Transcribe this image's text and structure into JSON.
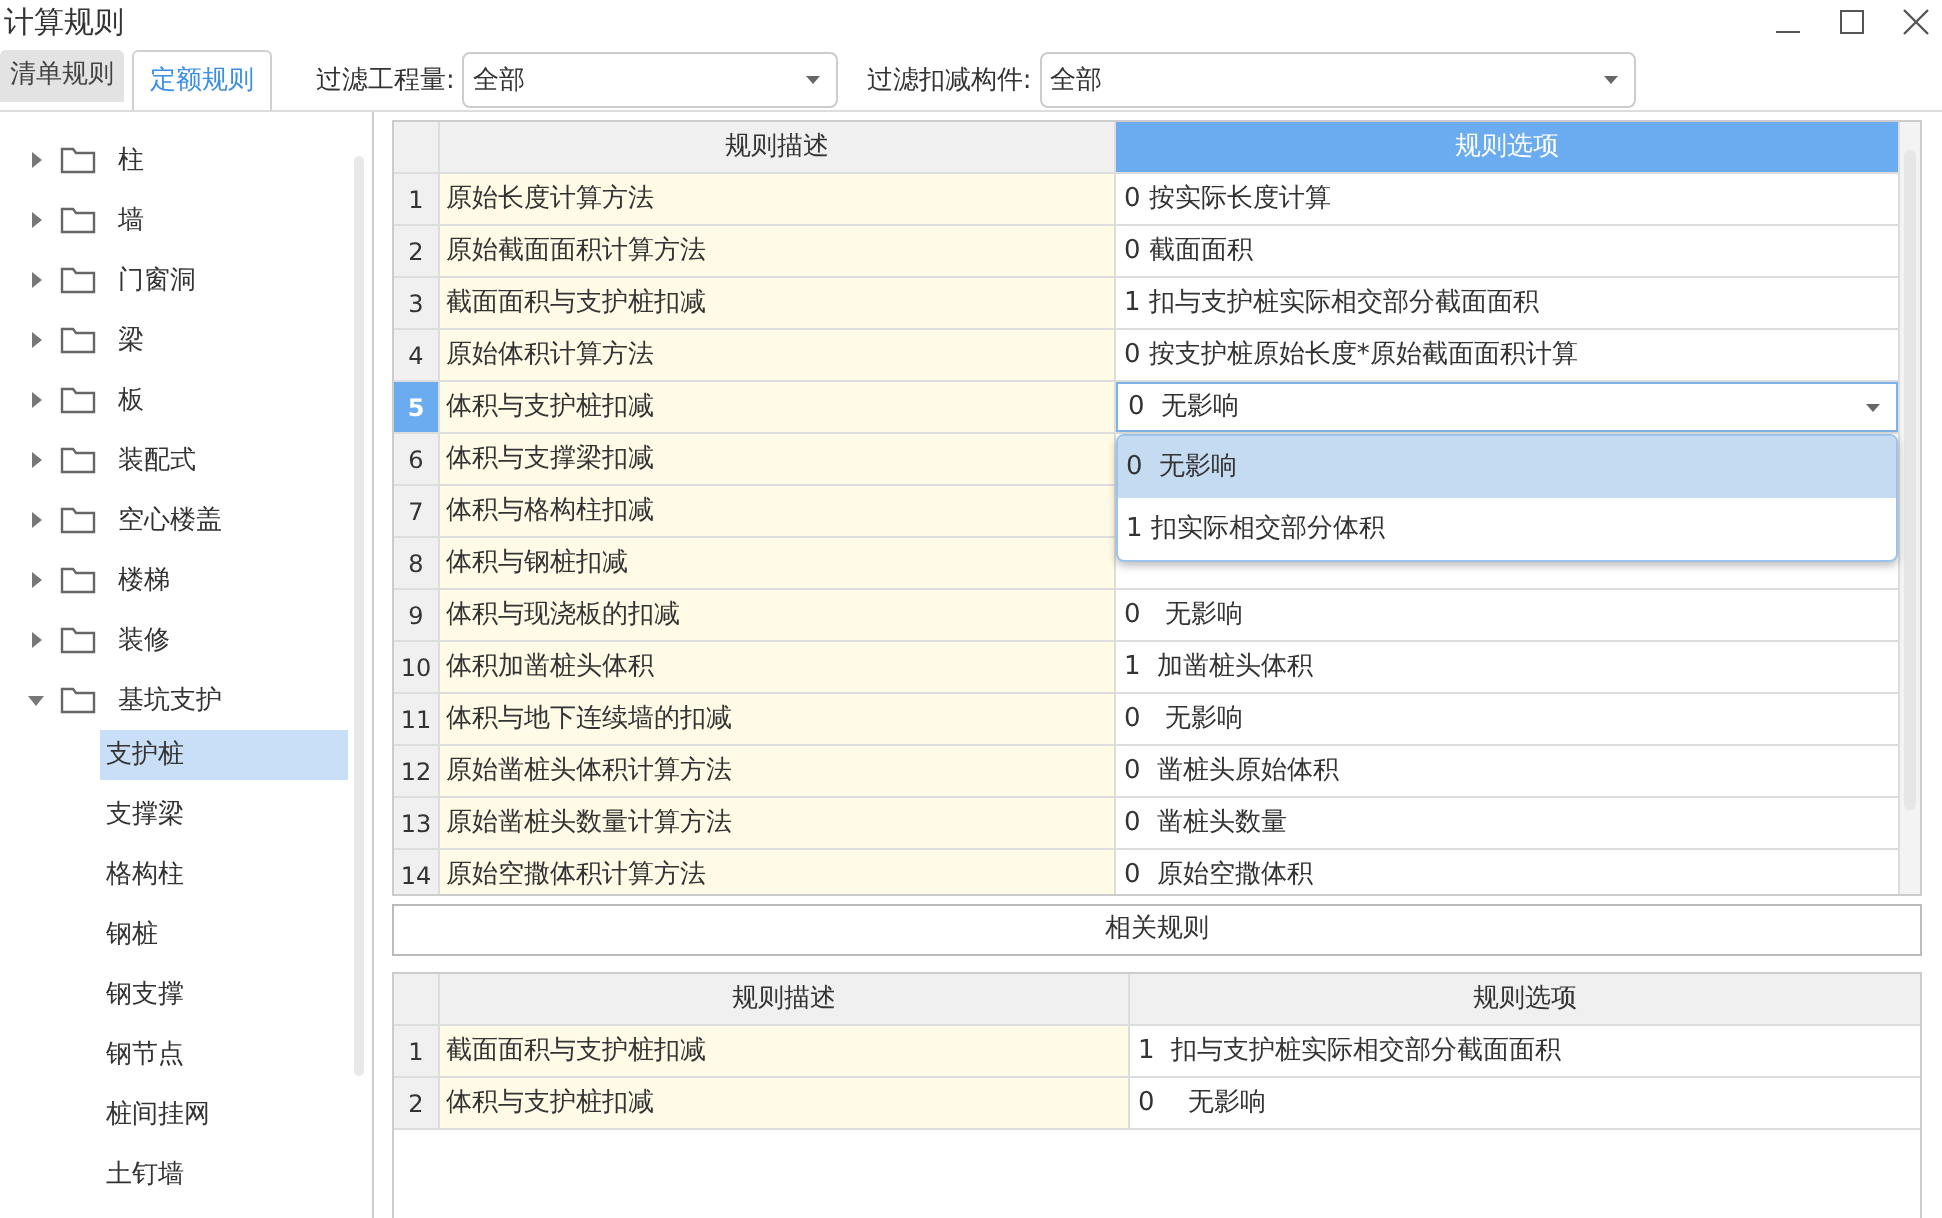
{
  "window": {
    "title": "计算规则"
  },
  "tabs": [
    {
      "label": "清单规则",
      "selected": false
    },
    {
      "label": "定额规则",
      "selected": true
    }
  ],
  "filters": [
    {
      "label": "过滤工程量:",
      "value": "全部"
    },
    {
      "label": "过滤扣减构件:",
      "value": "全部"
    }
  ],
  "tree": [
    {
      "label": "柱",
      "expanded": false
    },
    {
      "label": "墙",
      "expanded": false
    },
    {
      "label": "门窗洞",
      "expanded": false
    },
    {
      "label": "梁",
      "expanded": false
    },
    {
      "label": "板",
      "expanded": false
    },
    {
      "label": "装配式",
      "expanded": false
    },
    {
      "label": "空心楼盖",
      "expanded": false
    },
    {
      "label": "楼梯",
      "expanded": false
    },
    {
      "label": "装修",
      "expanded": false
    },
    {
      "label": "基坑支护",
      "expanded": true,
      "children": [
        {
          "label": "支护桩",
          "selected": true
        },
        {
          "label": "支撑梁",
          "selected": false
        },
        {
          "label": "格构柱",
          "selected": false
        },
        {
          "label": "钢桩",
          "selected": false
        },
        {
          "label": "钢支撑",
          "selected": false
        },
        {
          "label": "钢节点",
          "selected": false
        },
        {
          "label": "桩间挂网",
          "selected": false
        },
        {
          "label": "土钉墙",
          "selected": false
        }
      ]
    }
  ],
  "rules_table": {
    "columns": [
      {
        "label": "规则描述",
        "selected": false
      },
      {
        "label": "规则选项",
        "selected": true
      }
    ],
    "rows": [
      {
        "number": "1",
        "description": "原始长度计算方法",
        "option": "0 按实际长度计算",
        "selected": false
      },
      {
        "number": "2",
        "description": "原始截面面积计算方法",
        "option": "0 截面面积",
        "selected": false
      },
      {
        "number": "3",
        "description": "截面面积与支护桩扣减",
        "option": "1 扣与支护桩实际相交部分截面面积",
        "selected": false
      },
      {
        "number": "4",
        "description": "原始体积计算方法",
        "option": "0 按支护桩原始长度*原始截面面积计算",
        "selected": false
      },
      {
        "number": "5",
        "description": "体积与支护桩扣减",
        "option": "0  无影响",
        "selected": true
      },
      {
        "number": "6",
        "description": "体积与支撑梁扣减",
        "selected": false
      },
      {
        "number": "7",
        "description": "体积与格构柱扣减",
        "selected": false
      },
      {
        "number": "8",
        "description": "体积与钢桩扣减",
        "selected": false
      },
      {
        "number": "9",
        "description": "体积与现浇板的扣减",
        "option": "0   无影响",
        "selected": false
      },
      {
        "number": "10",
        "description": "体积加凿桩头体积",
        "option": "1  加凿桩头体积",
        "selected": false
      },
      {
        "number": "11",
        "description": "体积与地下连续墙的扣减",
        "option": "0   无影响",
        "selected": false
      },
      {
        "number": "12",
        "description": "原始凿桩头体积计算方法",
        "option": "0  凿桩头原始体积",
        "selected": false
      },
      {
        "number": "13",
        "description": "原始凿桩头数量计算方法",
        "option": "0  凿桩头数量",
        "selected": false
      },
      {
        "number": "14",
        "description": "原始空撒体积计算方法",
        "option": "0  原始空撒体积",
        "selected": false
      }
    ]
  },
  "dropdown": {
    "options": [
      {
        "label": "0  无影响",
        "selected": true
      },
      {
        "label": "1 扣实际相交部分体积",
        "selected": false
      }
    ]
  },
  "related": {
    "title": "相关规则",
    "columns": [
      "规则描述",
      "规则选项"
    ],
    "rows": [
      {
        "number": "1",
        "description": "截面面积与支护桩扣减",
        "option": "1  扣与支护桩实际相交部分截面面积"
      },
      {
        "number": "2",
        "description": "体积与支护桩扣减",
        "option": "0    无影响"
      }
    ]
  }
}
